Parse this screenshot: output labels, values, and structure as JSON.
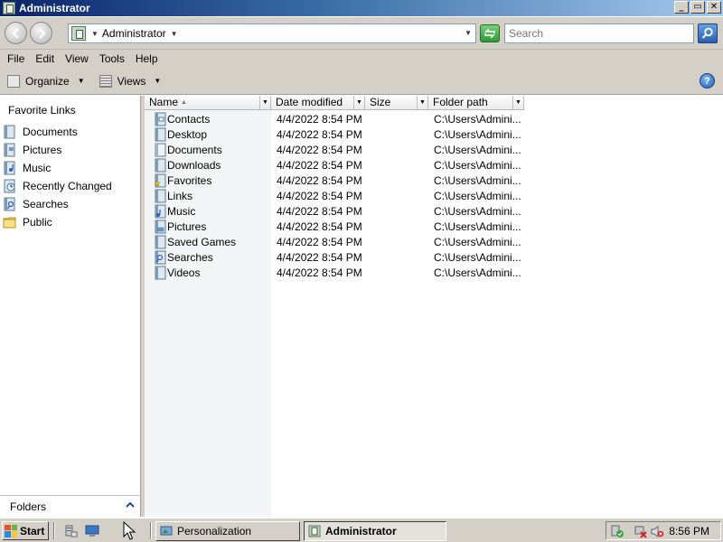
{
  "window": {
    "title": "Administrator",
    "buttons": {
      "minimize": "_",
      "maximize": "▭",
      "close": "✕"
    }
  },
  "address": {
    "crumb": "Administrator",
    "search_placeholder": "Search"
  },
  "menu": [
    "File",
    "Edit",
    "View",
    "Tools",
    "Help"
  ],
  "toolbar": {
    "organize_label": "Organize",
    "views_label": "Views",
    "help_label": "?"
  },
  "navpane": {
    "heading": "Favorite Links",
    "items": [
      {
        "label": "Documents",
        "icon": "documents-icon"
      },
      {
        "label": "Pictures",
        "icon": "pictures-icon"
      },
      {
        "label": "Music",
        "icon": "music-icon"
      },
      {
        "label": "Recently Changed",
        "icon": "recently-changed-icon"
      },
      {
        "label": "Searches",
        "icon": "searches-icon"
      },
      {
        "label": "Public",
        "icon": "public-folder-icon"
      }
    ],
    "folders_label": "Folders"
  },
  "columns": {
    "name": "Name",
    "date": "Date modified",
    "size": "Size",
    "path": "Folder path"
  },
  "files": [
    {
      "name": "Contacts",
      "date": "4/4/2022 8:54 PM",
      "size": "",
      "path": "C:\\Users\\Admini..."
    },
    {
      "name": "Desktop",
      "date": "4/4/2022 8:54 PM",
      "size": "",
      "path": "C:\\Users\\Admini..."
    },
    {
      "name": "Documents",
      "date": "4/4/2022 8:54 PM",
      "size": "",
      "path": "C:\\Users\\Admini..."
    },
    {
      "name": "Downloads",
      "date": "4/4/2022 8:54 PM",
      "size": "",
      "path": "C:\\Users\\Admini..."
    },
    {
      "name": "Favorites",
      "date": "4/4/2022 8:54 PM",
      "size": "",
      "path": "C:\\Users\\Admini..."
    },
    {
      "name": "Links",
      "date": "4/4/2022 8:54 PM",
      "size": "",
      "path": "C:\\Users\\Admini..."
    },
    {
      "name": "Music",
      "date": "4/4/2022 8:54 PM",
      "size": "",
      "path": "C:\\Users\\Admini..."
    },
    {
      "name": "Pictures",
      "date": "4/4/2022 8:54 PM",
      "size": "",
      "path": "C:\\Users\\Admini..."
    },
    {
      "name": "Saved Games",
      "date": "4/4/2022 8:54 PM",
      "size": "",
      "path": "C:\\Users\\Admini..."
    },
    {
      "name": "Searches",
      "date": "4/4/2022 8:54 PM",
      "size": "",
      "path": "C:\\Users\\Admini..."
    },
    {
      "name": "Videos",
      "date": "4/4/2022 8:54 PM",
      "size": "",
      "path": "C:\\Users\\Admini..."
    }
  ],
  "taskbar": {
    "start_label": "Start",
    "tasks": [
      {
        "label": "Personalization",
        "active": false
      },
      {
        "label": "Administrator",
        "active": true
      }
    ],
    "clock": "8:56 PM"
  }
}
